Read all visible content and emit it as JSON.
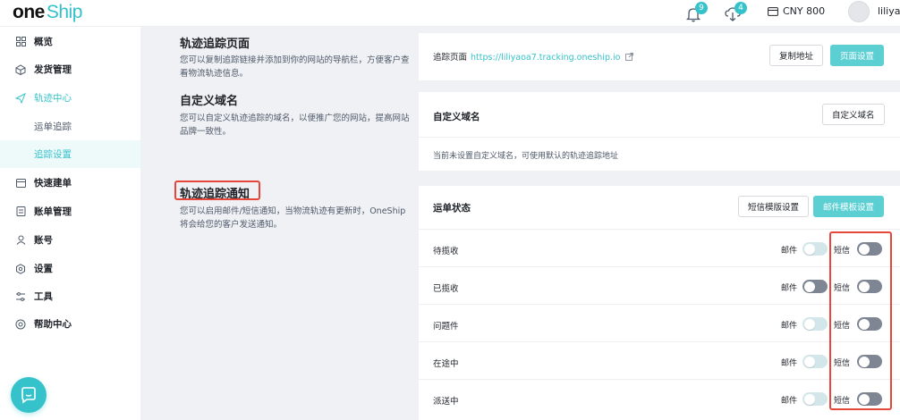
{
  "topbar": {
    "logo_main": "one",
    "logo_sub": "Ship",
    "notification_count": "9",
    "download_count": "4",
    "currency": "CNY 800",
    "username": "liliyao"
  },
  "sidebar": {
    "items": [
      {
        "label": "概览",
        "icon": "grid-icon"
      },
      {
        "label": "发货管理",
        "icon": "shipping-icon"
      },
      {
        "label": "轨迹中心",
        "icon": "send-icon"
      },
      {
        "label": "运单追踪",
        "icon": ""
      },
      {
        "label": "追踪设置",
        "icon": ""
      },
      {
        "label": "快速建单",
        "icon": "calendar-icon"
      },
      {
        "label": "账单管理",
        "icon": "bill-icon"
      },
      {
        "label": "账号",
        "icon": "user-icon"
      },
      {
        "label": "设置",
        "icon": "settings-icon"
      },
      {
        "label": "工具",
        "icon": "tools-icon"
      },
      {
        "label": "帮助中心",
        "icon": "help-icon"
      }
    ]
  },
  "sections": {
    "tracking_page": {
      "title": "轨迹追踪页面",
      "desc": "您可以复制追踪链接并添加到你的网站的导航栏，方便客户查看物流轨迹信息。",
      "url_label": "追踪页面",
      "url": "https://liliyaoa7.tracking.oneship.io",
      "copy_button": "复制地址",
      "settings_button": "页面设置"
    },
    "custom_domain": {
      "title": "自定义域名",
      "desc": "您可以自定义轨迹追踪的域名，以便推广您的网站，提高网站品牌一致性。",
      "card_title": "自定义域名",
      "button": "自定义域名",
      "note": "当前未设置自定义域名，可使用默认的轨迹追踪地址"
    },
    "notification": {
      "title": "轨迹追踪通知",
      "desc": "您可以启用邮件/短信通知，当物流轨迹有更新时，OneShip将会给您的客户发送通知。",
      "card_title": "运单状态",
      "sms_template_button": "短信模版设置",
      "email_template_button": "邮件模板设置",
      "email_label": "邮件",
      "sms_label": "短信",
      "statuses": [
        {
          "label": "待揽收",
          "email": "off",
          "sms": "off"
        },
        {
          "label": "已揽收",
          "email": "off",
          "sms": "off"
        },
        {
          "label": "问题件",
          "email": "off",
          "sms": "off"
        },
        {
          "label": "在途中",
          "email": "off",
          "sms": "off"
        },
        {
          "label": "派送中",
          "email": "off",
          "sms": "off"
        }
      ]
    }
  },
  "colors": {
    "brand": "#36c2ca",
    "highlight_border": "#e5483b"
  }
}
